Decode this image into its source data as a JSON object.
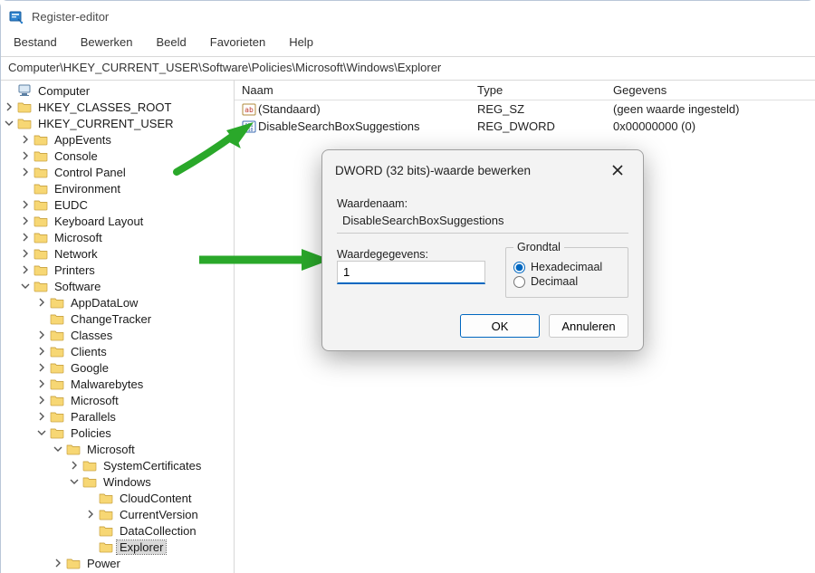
{
  "app": {
    "title": "Register-editor"
  },
  "menus": [
    "Bestand",
    "Bewerken",
    "Beeld",
    "Favorieten",
    "Help"
  ],
  "path": "Computer\\HKEY_CURRENT_USER\\Software\\Policies\\Microsoft\\Windows\\Explorer",
  "list": {
    "cols": {
      "name": "Naam",
      "type": "Type",
      "data": "Gegevens"
    },
    "rows": [
      {
        "icon": "sz",
        "name": "(Standaard)",
        "type": "REG_SZ",
        "data": "(geen waarde ingesteld)"
      },
      {
        "icon": "dword",
        "name": "DisableSearchBoxSuggestions",
        "type": "REG_DWORD",
        "data": "0x00000000 (0)"
      }
    ]
  },
  "dialog": {
    "title": "DWORD (32 bits)-waarde bewerken",
    "value_name_label": "Waardenaam:",
    "value_name": "DisableSearchBoxSuggestions",
    "value_data_label": "Waardegegevens:",
    "value_data": "1",
    "base_label": "Grondtal",
    "hex": "Hexadecimaal",
    "dec": "Decimaal",
    "ok": "OK",
    "cancel": "Annuleren"
  },
  "tree": [
    {
      "depth": 0,
      "expand": "none",
      "icon": "pc",
      "label": "Computer"
    },
    {
      "depth": 0,
      "expand": "right",
      "icon": "folder",
      "label": "HKEY_CLASSES_ROOT"
    },
    {
      "depth": 0,
      "expand": "down",
      "icon": "folder",
      "label": "HKEY_CURRENT_USER"
    },
    {
      "depth": 1,
      "expand": "right",
      "icon": "folder",
      "label": "AppEvents"
    },
    {
      "depth": 1,
      "expand": "right",
      "icon": "folder",
      "label": "Console"
    },
    {
      "depth": 1,
      "expand": "right",
      "icon": "folder",
      "label": "Control Panel"
    },
    {
      "depth": 1,
      "expand": "none",
      "icon": "folder",
      "label": "Environment"
    },
    {
      "depth": 1,
      "expand": "right",
      "icon": "folder",
      "label": "EUDC"
    },
    {
      "depth": 1,
      "expand": "right",
      "icon": "folder",
      "label": "Keyboard Layout"
    },
    {
      "depth": 1,
      "expand": "right",
      "icon": "folder",
      "label": "Microsoft"
    },
    {
      "depth": 1,
      "expand": "right",
      "icon": "folder",
      "label": "Network"
    },
    {
      "depth": 1,
      "expand": "right",
      "icon": "folder",
      "label": "Printers"
    },
    {
      "depth": 1,
      "expand": "down",
      "icon": "folder",
      "label": "Software"
    },
    {
      "depth": 2,
      "expand": "right",
      "icon": "folder",
      "label": "AppDataLow"
    },
    {
      "depth": 2,
      "expand": "none",
      "icon": "folder",
      "label": "ChangeTracker"
    },
    {
      "depth": 2,
      "expand": "right",
      "icon": "folder",
      "label": "Classes"
    },
    {
      "depth": 2,
      "expand": "right",
      "icon": "folder",
      "label": "Clients"
    },
    {
      "depth": 2,
      "expand": "right",
      "icon": "folder",
      "label": "Google"
    },
    {
      "depth": 2,
      "expand": "right",
      "icon": "folder",
      "label": "Malwarebytes"
    },
    {
      "depth": 2,
      "expand": "right",
      "icon": "folder",
      "label": "Microsoft"
    },
    {
      "depth": 2,
      "expand": "right",
      "icon": "folder",
      "label": "Parallels"
    },
    {
      "depth": 2,
      "expand": "down",
      "icon": "folder",
      "label": "Policies"
    },
    {
      "depth": 3,
      "expand": "down",
      "icon": "folder",
      "label": "Microsoft"
    },
    {
      "depth": 4,
      "expand": "right",
      "icon": "folder",
      "label": "SystemCertificates"
    },
    {
      "depth": 4,
      "expand": "down",
      "icon": "folder",
      "label": "Windows"
    },
    {
      "depth": 5,
      "expand": "none",
      "icon": "folder",
      "label": "CloudContent"
    },
    {
      "depth": 5,
      "expand": "right",
      "icon": "folder",
      "label": "CurrentVersion"
    },
    {
      "depth": 5,
      "expand": "none",
      "icon": "folder",
      "label": "DataCollection"
    },
    {
      "depth": 5,
      "expand": "none",
      "icon": "folder",
      "label": "Explorer",
      "selected": true
    },
    {
      "depth": 3,
      "expand": "right",
      "icon": "folder",
      "label": "Power"
    }
  ]
}
